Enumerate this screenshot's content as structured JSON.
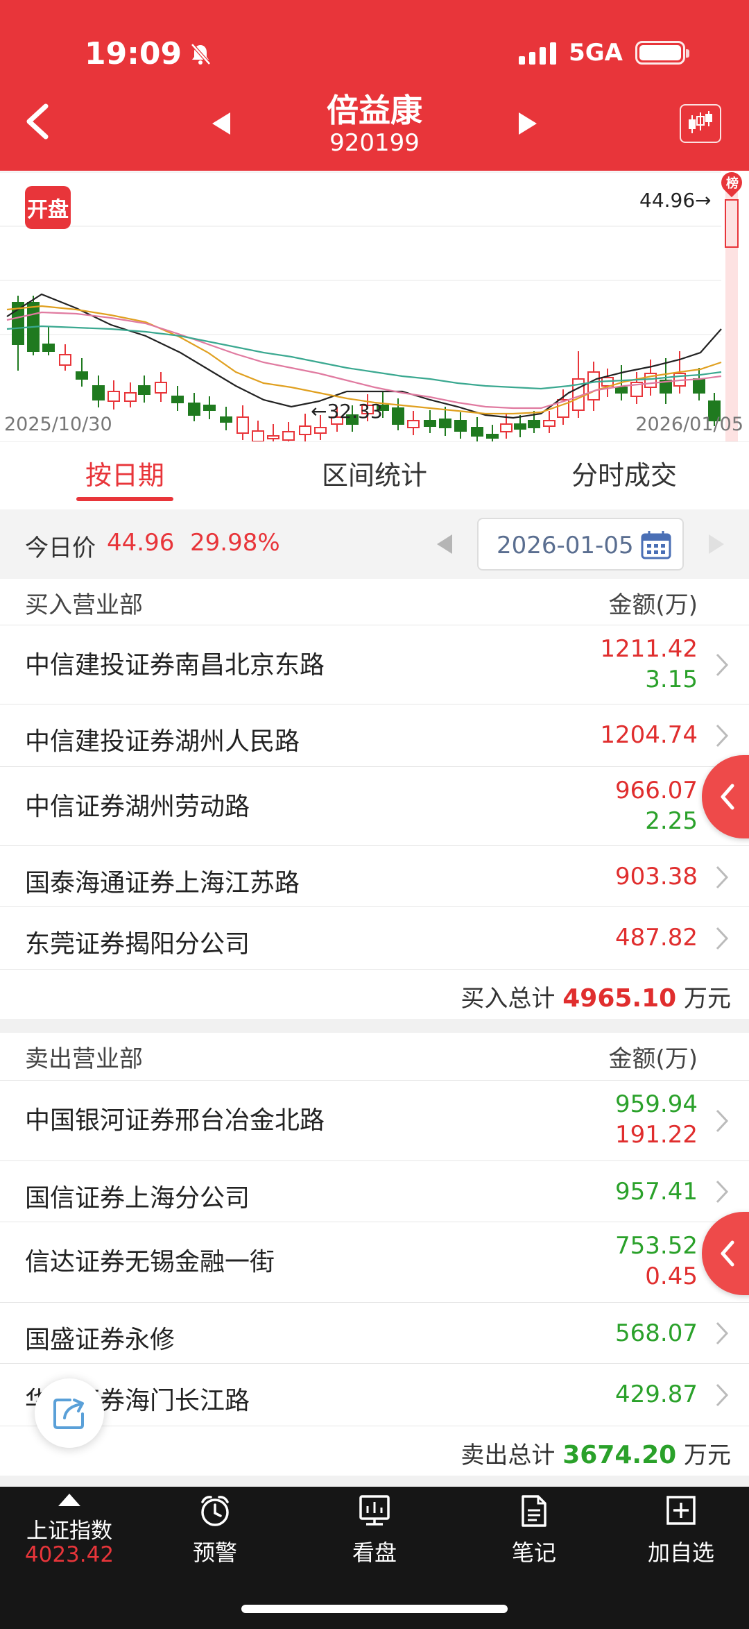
{
  "status_bar": {
    "time": "19:09",
    "network": "5GA"
  },
  "header": {
    "stock_name": "倍益康",
    "stock_code": "920199"
  },
  "chart": {
    "badge": "开盘",
    "rank_badge": "榜",
    "high_label": "44.96",
    "low_label": "32.33",
    "date_start": "2025/10/30",
    "date_end": "2026/01/05"
  },
  "chart_data": {
    "type": "candlestick",
    "x_range": [
      "2025/10/30",
      "2026/01/05"
    ],
    "annotations": {
      "high": 44.96,
      "low": 32.33
    },
    "colors": {
      "up": "#e8353a",
      "down": "#1f7a1f",
      "ma1": "#222222",
      "ma2": "#e0a020",
      "ma3": "#e07aa0",
      "ma4": "#3aa890"
    }
  },
  "tabs": [
    {
      "label": "按日期",
      "active": true
    },
    {
      "label": "区间统计",
      "active": false
    },
    {
      "label": "分时成交",
      "active": false
    }
  ],
  "price_bar": {
    "label": "今日价",
    "price": "44.96",
    "change_pct": "29.98%",
    "date": "2026-01-05"
  },
  "buy": {
    "header": "买入营业部",
    "amount_header": "金额(万)",
    "rows": [
      {
        "name": "中信建投证券南昌北京东路",
        "v1": "1211.42",
        "v2": "3.15"
      },
      {
        "name": "中信建投证券湖州人民路",
        "v1": "1204.74",
        "v2": ""
      },
      {
        "name": "中信证券湖州劳动路",
        "v1": "966.07",
        "v2": "2.25"
      },
      {
        "name": "国泰海通证券上海江苏路",
        "v1": "903.38",
        "v2": ""
      },
      {
        "name": "东莞证券揭阳分公司",
        "v1": "487.82",
        "v2": ""
      }
    ],
    "total_label": "买入总计",
    "total_value": "4965.10",
    "total_unit": "万元"
  },
  "sell": {
    "header": "卖出营业部",
    "amount_header": "金额(万)",
    "rows": [
      {
        "name": "中国银河证券邢台冶金北路",
        "v1": "959.94",
        "v2": "191.22"
      },
      {
        "name": "国信证券上海分公司",
        "v1": "957.41",
        "v2": ""
      },
      {
        "name": "信达证券无锡金融一街",
        "v1": "753.52",
        "v2": "0.45"
      },
      {
        "name": "国盛证券永修",
        "v1": "568.07",
        "v2": ""
      },
      {
        "name": "华泰证券海门长江路",
        "v1": "429.87",
        "v2": ""
      }
    ],
    "total_label": "卖出总计",
    "total_value": "3674.20",
    "total_unit": "万元"
  },
  "bottom_nav": {
    "index_name": "上证指数",
    "index_value": "4023.42",
    "items": [
      "预警",
      "看盘",
      "笔记",
      "加自选"
    ]
  }
}
